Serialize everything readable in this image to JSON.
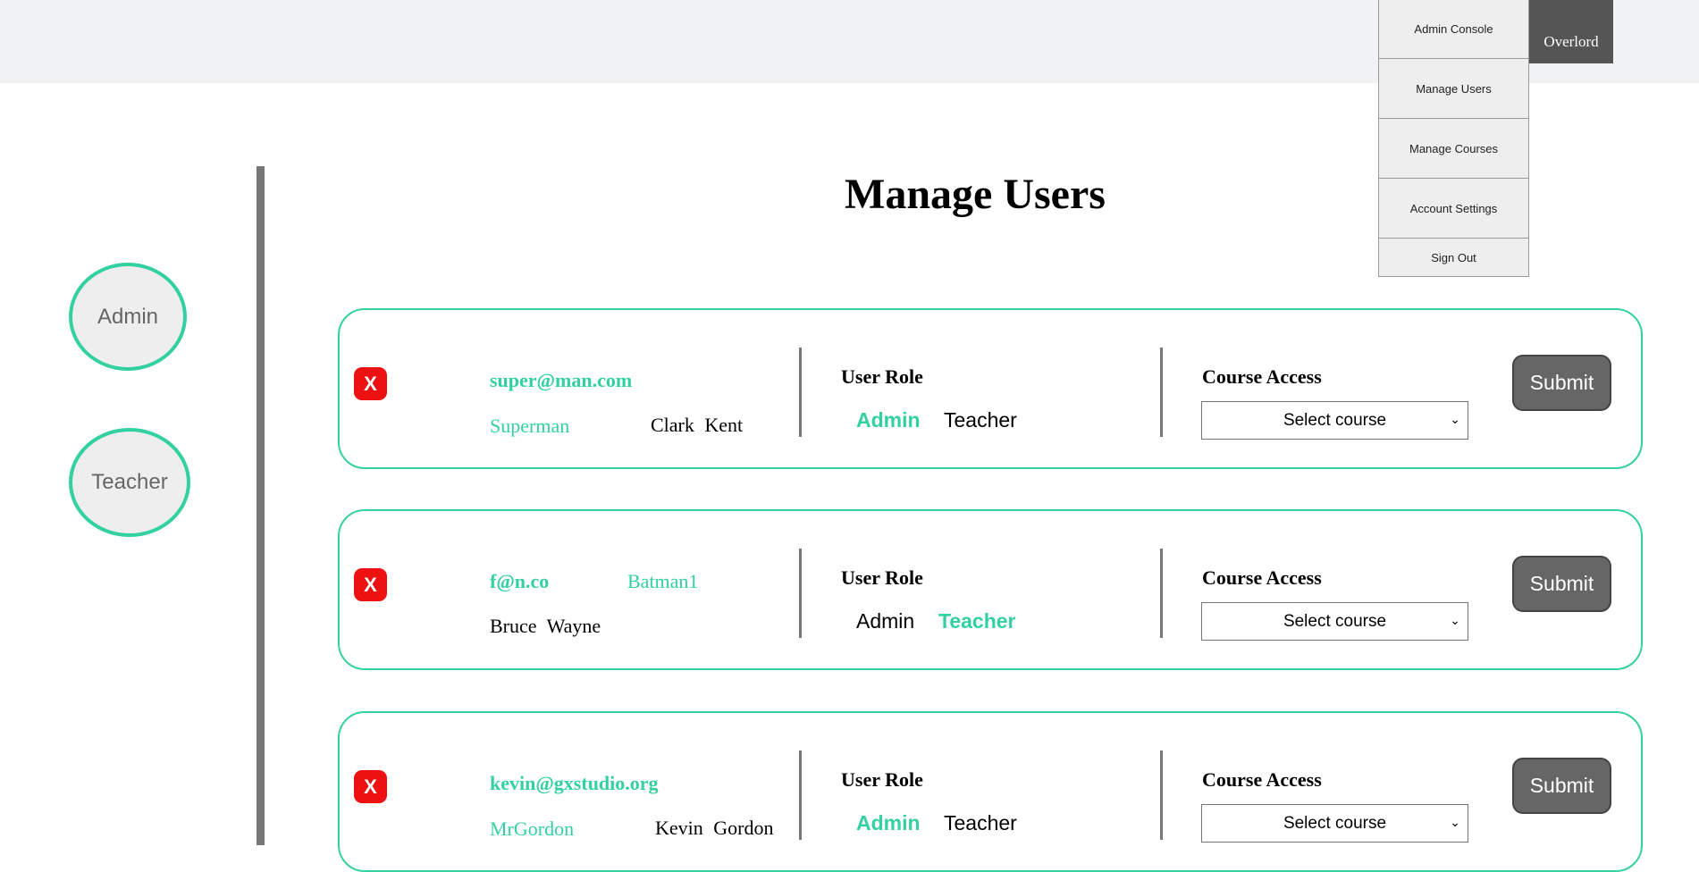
{
  "header": {
    "user_name": "Overlord",
    "menu": [
      "Admin Console",
      "Manage Users",
      "Manage Courses",
      "Account Settings",
      "Sign Out"
    ]
  },
  "sidebar": {
    "roles": [
      "Admin",
      "Teacher"
    ]
  },
  "page": {
    "title": "Manage Users"
  },
  "labels": {
    "user_role": "User Role",
    "course_access": "Course Access",
    "select_course": "Select course",
    "submit": "Submit",
    "delete": "X",
    "role_admin": "Admin",
    "role_teacher": "Teacher"
  },
  "users": [
    {
      "email": "super@man.com",
      "username": "Superman",
      "full_name": "Clark Kent",
      "role": "Admin"
    },
    {
      "email": "f@n.co",
      "username": "Batman1",
      "full_name": "Bruce Wayne",
      "role": "Teacher"
    },
    {
      "email": "kevin@gxstudio.org",
      "username": "MrGordon",
      "full_name": "Kevin Gordon",
      "role": "Admin"
    }
  ],
  "colors": {
    "accent": "#33d1a0",
    "delete": "#ee1111",
    "button": "#666666"
  }
}
